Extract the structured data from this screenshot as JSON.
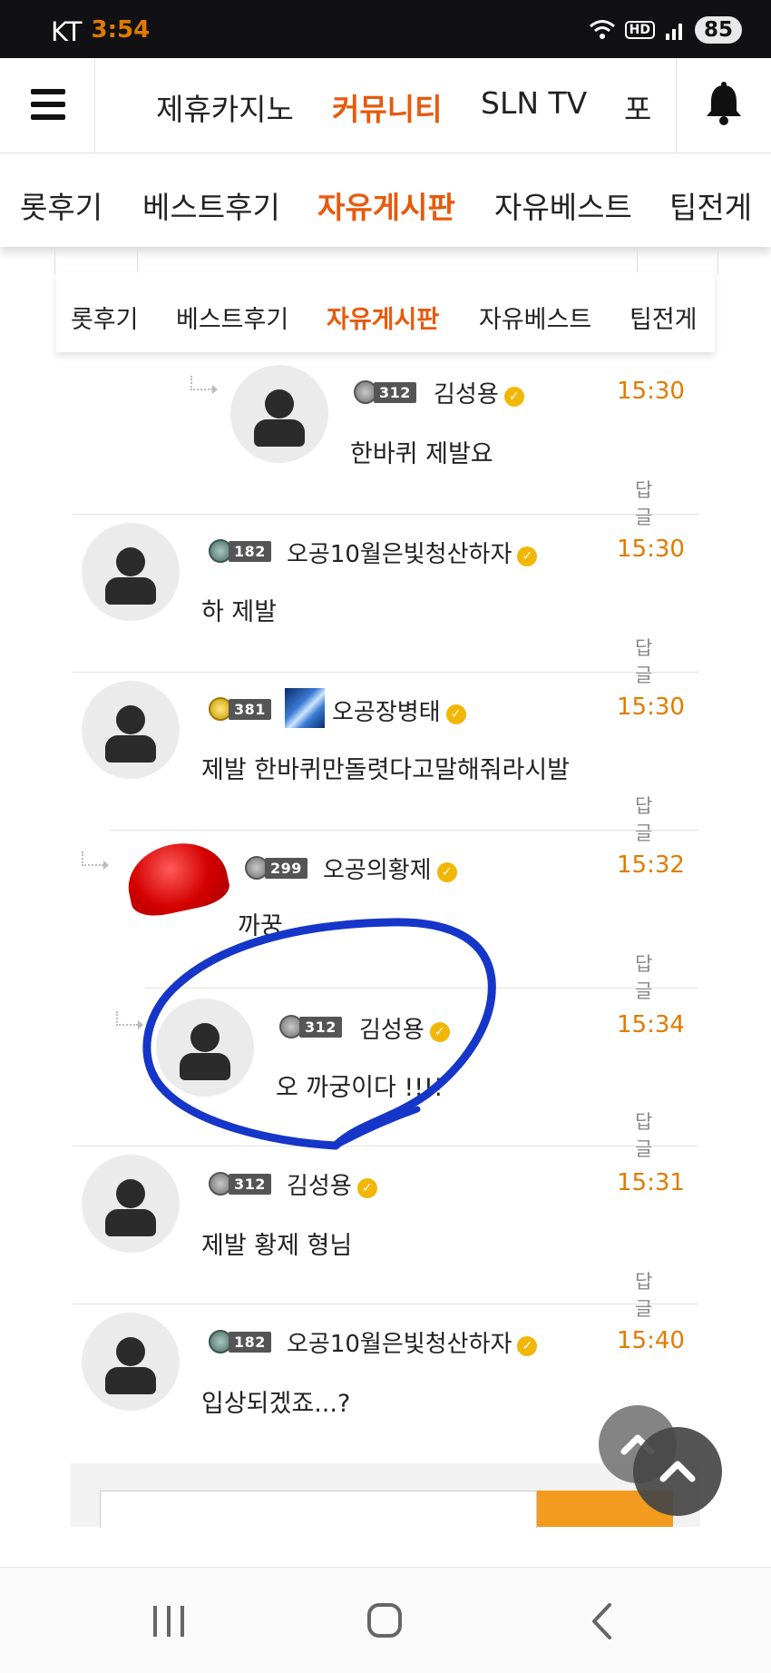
{
  "status_bar": {
    "carrier": "KT",
    "time": "3:54",
    "hd": "HD",
    "battery": "85"
  },
  "top_nav": {
    "items": [
      "제휴카지노",
      "커뮤니티",
      "SLN TV",
      "포"
    ]
  },
  "sub_nav": {
    "items": [
      "롯후기",
      "베스트후기",
      "자유게시판",
      "자유베스트",
      "팁전게"
    ]
  },
  "sub_nav_inner": {
    "items": [
      "롯후기",
      "베스트후기",
      "자유게시판",
      "자유베스트",
      "팁전게"
    ]
  },
  "comments": [
    {
      "level": "312",
      "nickname": "김성용",
      "time": "15:30",
      "text": "한바퀴 제발요",
      "reply_label": "답글",
      "is_reply": true
    },
    {
      "level": "182",
      "nickname": "오공10월은빛청산하자",
      "time": "15:30",
      "text": "하 제발",
      "reply_label": "답글",
      "is_reply": false
    },
    {
      "level": "381",
      "nickname": "오공장병태",
      "time": "15:30",
      "text": "제발 한바퀴만돌렷다고말해줘라시발",
      "reply_label": "답글",
      "is_reply": false
    },
    {
      "level": "299",
      "nickname": "오공의황제",
      "time": "15:32",
      "text": "까꿍",
      "reply_label": "답글",
      "is_reply": true
    },
    {
      "level": "312",
      "nickname": "김성용",
      "time": "15:34",
      "text": "오 까궁이다 !!!!",
      "reply_label": "답글",
      "is_reply": true
    },
    {
      "level": "312",
      "nickname": "김성용",
      "time": "15:31",
      "text": "제발 황제 형님",
      "reply_label": "답글",
      "is_reply": false
    },
    {
      "level": "182",
      "nickname": "오공10월은빛청산하자",
      "time": "15:40",
      "text": "입상되겠죠...?",
      "reply_label": "",
      "is_reply": false
    }
  ],
  "colors": {
    "accent": "#e8590c",
    "time": "#e07b00",
    "scribble": "#1536c8",
    "verified": "#f2b705"
  },
  "icons": [
    "menu-icon",
    "bell-icon",
    "verified-icon",
    "scroll-top-icon",
    "recent-apps-icon",
    "home-icon",
    "back-icon"
  ]
}
